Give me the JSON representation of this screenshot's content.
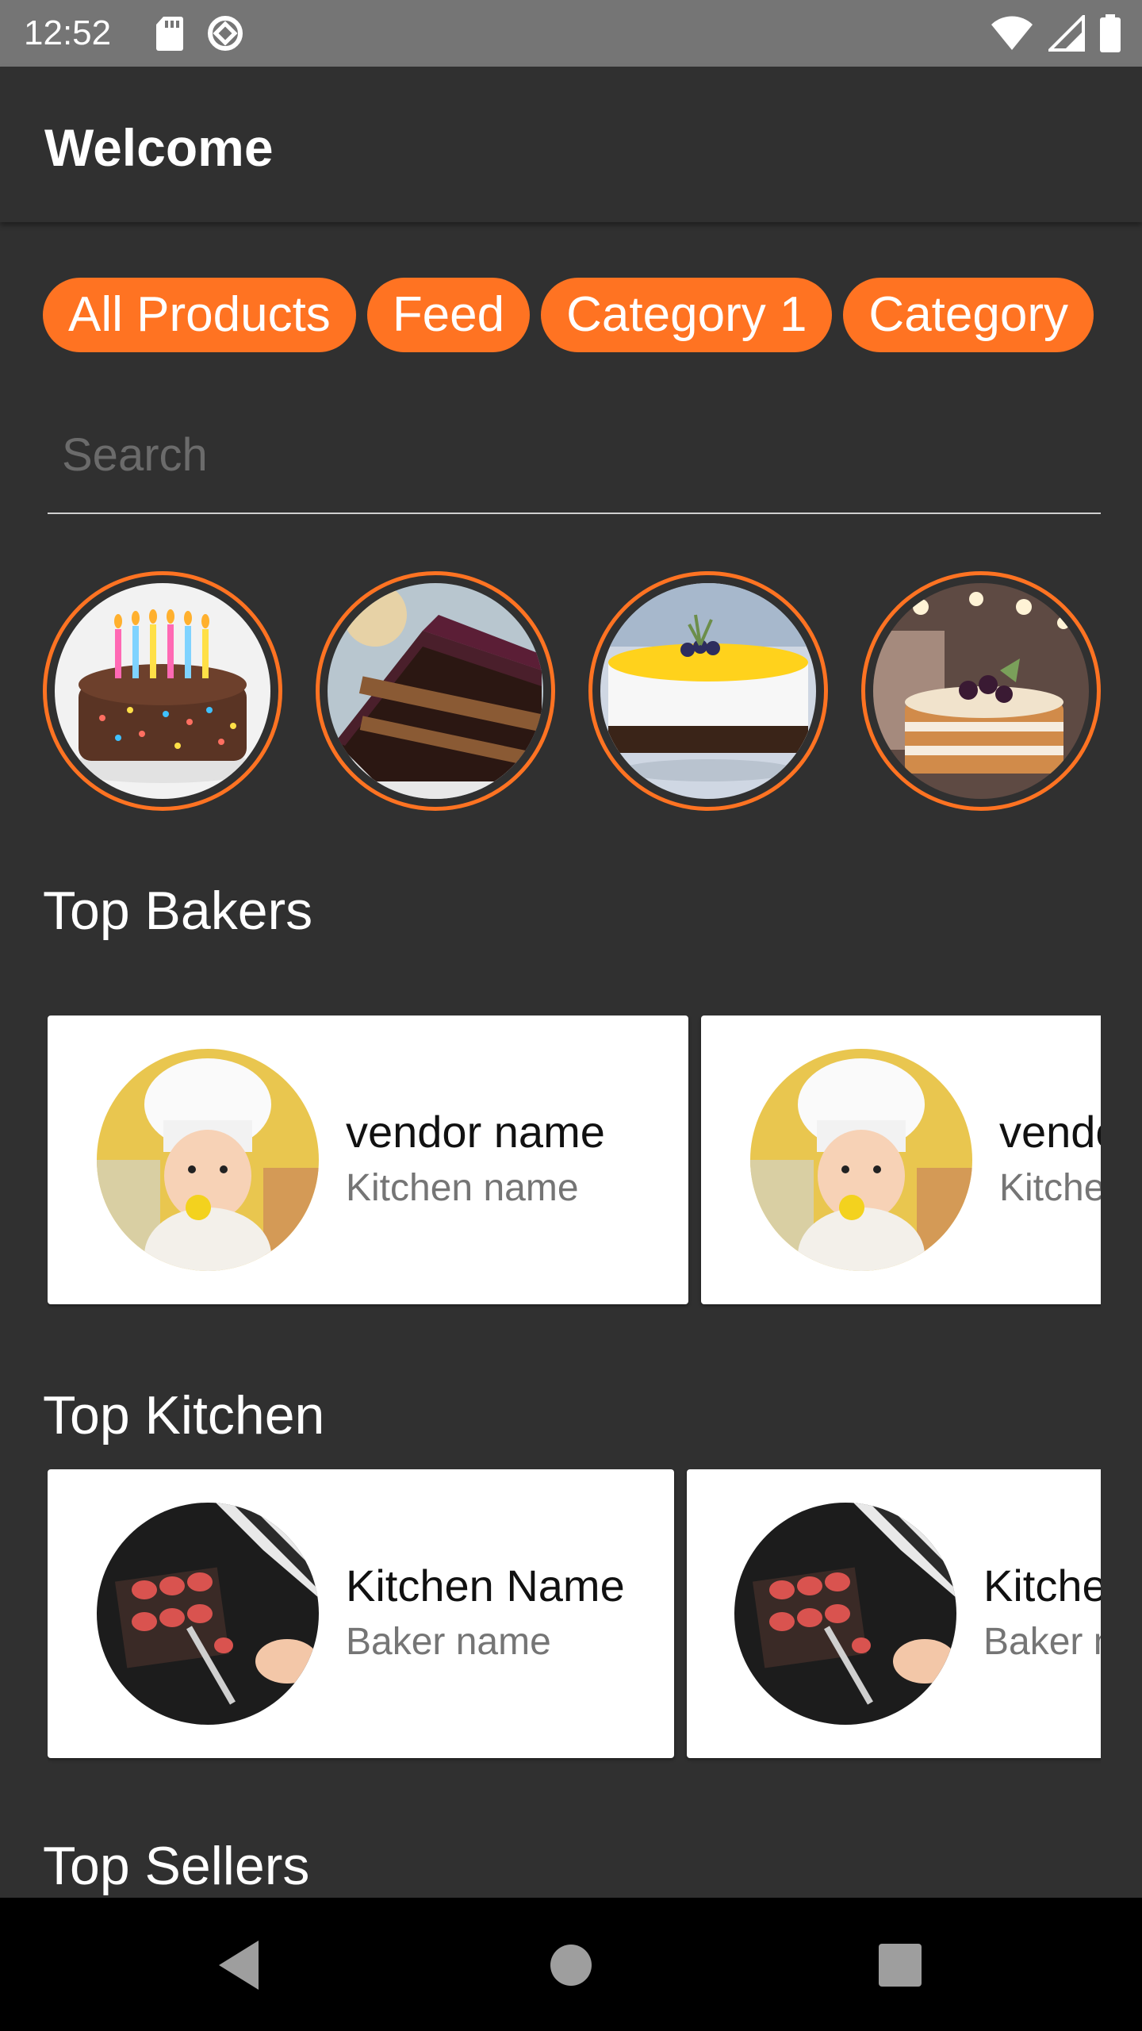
{
  "status_bar": {
    "time": "12:52",
    "left_icons": [
      "sd-card-icon",
      "data-saver-icon"
    ],
    "right_icons": [
      "wifi-icon",
      "signal-icon",
      "battery-icon"
    ]
  },
  "app_bar": {
    "title": "Welcome"
  },
  "chips": [
    {
      "label": "All Products"
    },
    {
      "label": "Feed"
    },
    {
      "label": "Category 1"
    },
    {
      "label": "Category"
    }
  ],
  "search": {
    "placeholder": "Search",
    "value": ""
  },
  "categories": [
    {
      "icon": "birthday-cake-image"
    },
    {
      "icon": "chocolate-cake-slice-image"
    },
    {
      "icon": "cream-cake-image"
    },
    {
      "icon": "naked-cake-image"
    }
  ],
  "top_bakers": {
    "title": "Top Bakers",
    "cards": [
      {
        "name": "vendor name",
        "sub": "Kitchen name"
      },
      {
        "name": "vendor name",
        "sub": "Kitchen name"
      }
    ]
  },
  "top_kitchen": {
    "title": "Top Kitchen",
    "cards": [
      {
        "name": "Kitchen Name",
        "sub": "Baker name"
      },
      {
        "name": "Kitchen Name",
        "sub": "Baker name"
      }
    ]
  },
  "top_sellers": {
    "title": "Top Sellers"
  },
  "colors": {
    "accent": "#ff7322",
    "background": "#303030",
    "card": "#ffffff"
  },
  "nav": [
    "back-icon",
    "home-icon",
    "recents-icon"
  ]
}
